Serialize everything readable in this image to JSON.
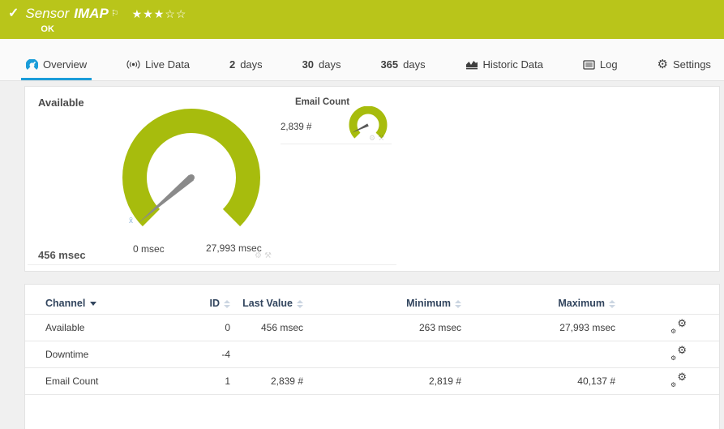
{
  "header": {
    "check_icon": "✓",
    "title_prefix": "Sensor",
    "title_name": "IMAP",
    "flag_icon": "⚐",
    "stars_filled": "★★★",
    "stars_empty": "☆☆",
    "status": "OK",
    "bg_color": "#b9c51a"
  },
  "tabs": {
    "overview": {
      "label": "Overview",
      "active": true
    },
    "live_data": {
      "label": "Live Data"
    },
    "days2": {
      "num": "2",
      "label": "days"
    },
    "days30": {
      "num": "30",
      "label": "days"
    },
    "days365": {
      "num": "365",
      "label": "days"
    },
    "historic": {
      "label": "Historic Data"
    },
    "log": {
      "label": "Log"
    },
    "settings": {
      "label": "Settings"
    }
  },
  "gauges": {
    "available": {
      "title": "Available",
      "current": "456 msec",
      "scale_min": "0 msec",
      "scale_max": "27,993 msec",
      "value": 456,
      "min": 0,
      "max": 27993,
      "avg_marker": "x̄",
      "color": "#a7bc0d",
      "needle_color": "#8a8a8a"
    },
    "email_count": {
      "title": "Email Count",
      "current": "2,839 #",
      "value": 2839,
      "min": 0,
      "max": 40137,
      "color": "#a7bc0d",
      "needle_color": "#5a5a5a"
    }
  },
  "table": {
    "col_channel": "Channel",
    "col_id": "ID",
    "col_last_value": "Last Value",
    "col_minimum": "Minimum",
    "col_maximum": "Maximum",
    "rows": [
      {
        "channel": "Available",
        "id": "0",
        "last": "456 msec",
        "min": "263 msec",
        "max": "27,993 msec"
      },
      {
        "channel": "Downtime",
        "id": "-4",
        "last": "",
        "min": "",
        "max": ""
      },
      {
        "channel": "Email Count",
        "id": "1",
        "last": "2,839 #",
        "min": "2,819 #",
        "max": "40,137 #"
      }
    ]
  },
  "icons": {
    "gear": "⚙",
    "tools": "⚒"
  },
  "colors": {
    "header_green": "#b9c51a",
    "gauge_green": "#a7bc0d",
    "active_tab_blue": "#1b9dd9",
    "table_header_navy": "#32455e"
  }
}
